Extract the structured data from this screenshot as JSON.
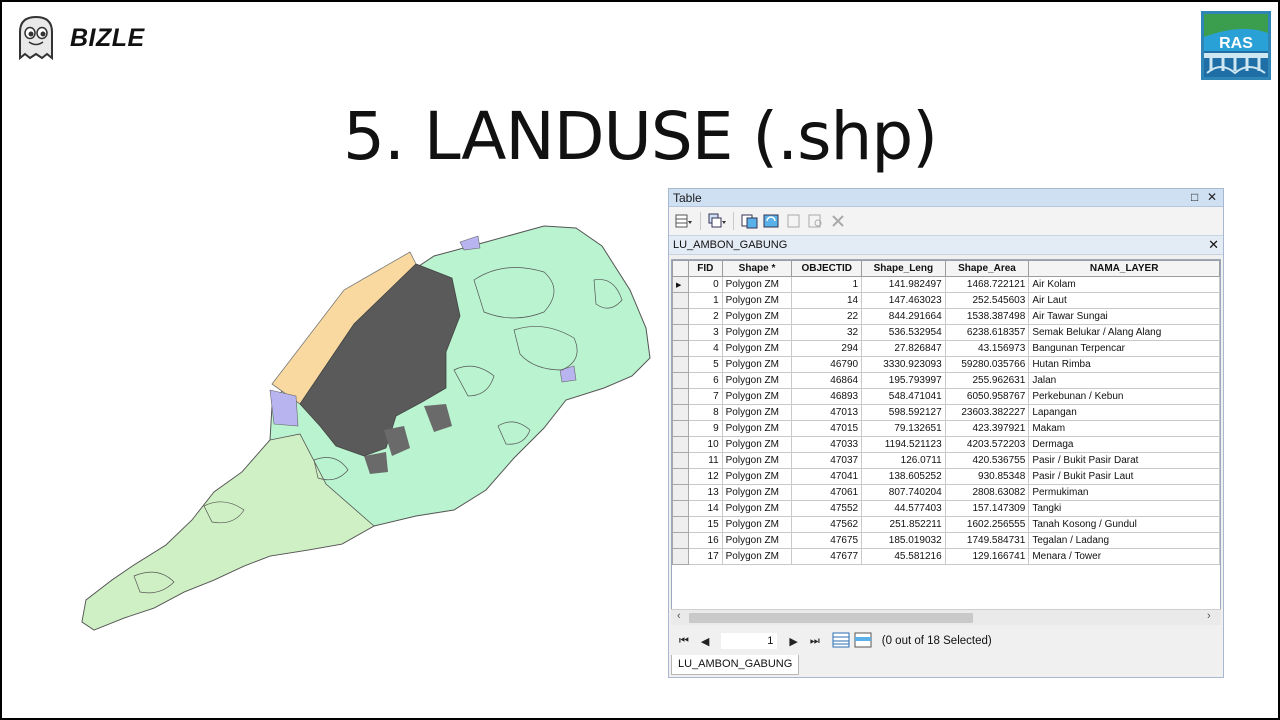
{
  "brand": {
    "name": "BIZLE",
    "logo_icon": "ghost-icon"
  },
  "ras_logo": {
    "text": "RAS",
    "icon": "ras-bridge-logo"
  },
  "slide_title": "5. LANDUSE (.shp)",
  "table_window": {
    "title": "Table",
    "toolbar": {
      "buttons": [
        "table-options-icon",
        "related-tables-icon",
        "select-by-attributes-icon",
        "switch-selection-icon",
        "clear-selection-icon",
        "zoom-to-selected-icon",
        "delete-selected-icon"
      ]
    },
    "tab_name": "LU_AMBON_GABUNG",
    "columns": [
      "FID",
      "Shape *",
      "OBJECTID",
      "Shape_Leng",
      "Shape_Area",
      "NAMA_LAYER"
    ],
    "rows": [
      [
        "0",
        "Polygon ZM",
        "1",
        "141.982497",
        "1468.722121",
        "Air Kolam"
      ],
      [
        "1",
        "Polygon ZM",
        "14",
        "147.463023",
        "252.545603",
        "Air Laut"
      ],
      [
        "2",
        "Polygon ZM",
        "22",
        "844.291664",
        "1538.387498",
        "Air Tawar Sungai"
      ],
      [
        "3",
        "Polygon ZM",
        "32",
        "536.532954",
        "6238.618357",
        "Semak Belukar / Alang Alang"
      ],
      [
        "4",
        "Polygon ZM",
        "294",
        "27.826847",
        "43.156973",
        "Bangunan Terpencar"
      ],
      [
        "5",
        "Polygon ZM",
        "46790",
        "3330.923093",
        "59280.035766",
        "Hutan Rimba"
      ],
      [
        "6",
        "Polygon ZM",
        "46864",
        "195.793997",
        "255.962631",
        "Jalan"
      ],
      [
        "7",
        "Polygon ZM",
        "46893",
        "548.471041",
        "6050.958767",
        "Perkebunan / Kebun"
      ],
      [
        "8",
        "Polygon ZM",
        "47013",
        "598.592127",
        "23603.382227",
        "Lapangan"
      ],
      [
        "9",
        "Polygon ZM",
        "47015",
        "79.132651",
        "423.397921",
        "Makam"
      ],
      [
        "10",
        "Polygon ZM",
        "47033",
        "1194.521123",
        "4203.572203",
        "Dermaga"
      ],
      [
        "11",
        "Polygon ZM",
        "47037",
        "126.0711",
        "420.536755",
        "Pasir / Bukit Pasir Darat"
      ],
      [
        "12",
        "Polygon ZM",
        "47041",
        "138.605252",
        "930.85348",
        "Pasir / Bukit Pasir Laut"
      ],
      [
        "13",
        "Polygon ZM",
        "47061",
        "807.740204",
        "2808.63082",
        "Permukiman"
      ],
      [
        "14",
        "Polygon ZM",
        "47552",
        "44.577403",
        "157.147309",
        "Tangki"
      ],
      [
        "15",
        "Polygon ZM",
        "47562",
        "251.852211",
        "1602.256555",
        "Tanah Kosong / Gundul"
      ],
      [
        "16",
        "Polygon ZM",
        "47675",
        "185.019032",
        "1749.584731",
        "Tegalan / Ladang"
      ],
      [
        "17",
        "Polygon ZM",
        "47677",
        "45.581216",
        "129.166741",
        "Menara / Tower"
      ]
    ],
    "current_record": "1",
    "selection_status": "(0 out of 18 Selected)",
    "bottom_tab": "LU_AMBON_GABUNG"
  },
  "colors": {
    "titlebar": "#cfe0f3",
    "map_green": "#b9f3cf",
    "map_lightgreen": "#d3f0c0",
    "map_gray": "#5a5a5a",
    "map_sand": "#f9d9a0",
    "map_purple": "#b8b4f0"
  }
}
